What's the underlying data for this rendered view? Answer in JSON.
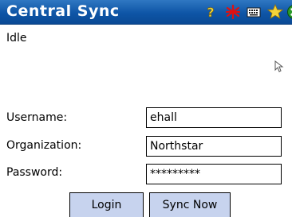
{
  "app": {
    "title": "Central Sync"
  },
  "titlebar_icons": [
    "help-icon",
    "connectivity-icon",
    "input-panel-icon",
    "star-icon",
    "close-icon"
  ],
  "status": {
    "text": "Idle"
  },
  "form": {
    "username_label": "Username:",
    "username_value": "ehall",
    "organization_label": "Organization:",
    "organization_value": "Northstar",
    "password_label": "Password:",
    "password_value": "*********"
  },
  "buttons": {
    "login": "Login",
    "sync_now": "Sync Now"
  },
  "colors": {
    "titlebar": "#0e55a6",
    "button": "#c7d3ee",
    "close_icon": "#2a9a2a"
  }
}
